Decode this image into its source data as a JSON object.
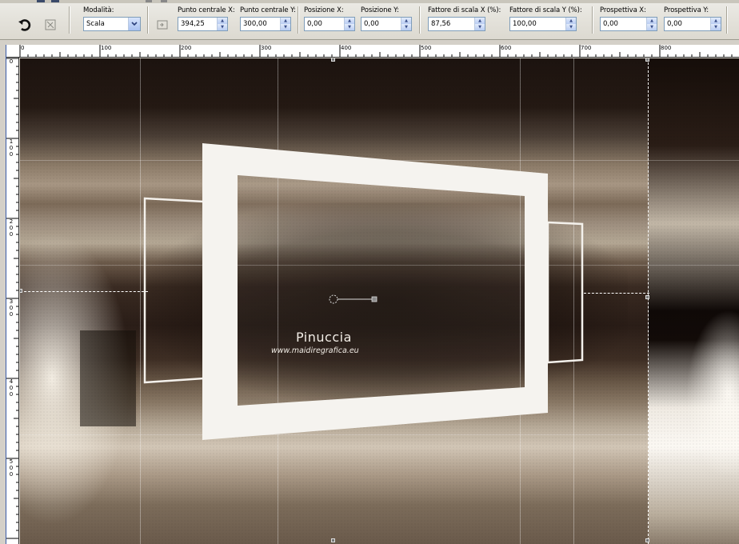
{
  "toolbar": {
    "mode": {
      "label": "Modalità:",
      "value": "Scala"
    },
    "center_x": {
      "label": "Punto centrale X:",
      "value": "394,25"
    },
    "center_y": {
      "label": "Punto centrale Y:",
      "value": "300,00"
    },
    "pos_x": {
      "label": "Posizione X:",
      "value": "0,00"
    },
    "pos_y": {
      "label": "Posizione Y:",
      "value": "0,00"
    },
    "scale_x": {
      "label": "Fattore di scala X (%):",
      "value": "87,56"
    },
    "scale_y": {
      "label": "Fattore di scala Y (%):",
      "value": "100,00"
    },
    "persp_x": {
      "label": "Prospettiva X:",
      "value": "0,00"
    },
    "persp_y": {
      "label": "Prospettiva Y:",
      "value": "0,00"
    }
  },
  "ruler": {
    "horizontal": [
      "0",
      "100",
      "200",
      "300",
      "400",
      "500",
      "600",
      "700",
      "800"
    ],
    "vertical": [
      "0",
      "100",
      "200",
      "300",
      "400",
      "500"
    ]
  },
  "canvas": {
    "watermark_name": "Pinuccia",
    "watermark_url": "www.maidiregrafica.eu"
  },
  "icons": {
    "reset": "undo-arrow-icon",
    "deform": "deform-icon",
    "apply": "apply-icon"
  }
}
